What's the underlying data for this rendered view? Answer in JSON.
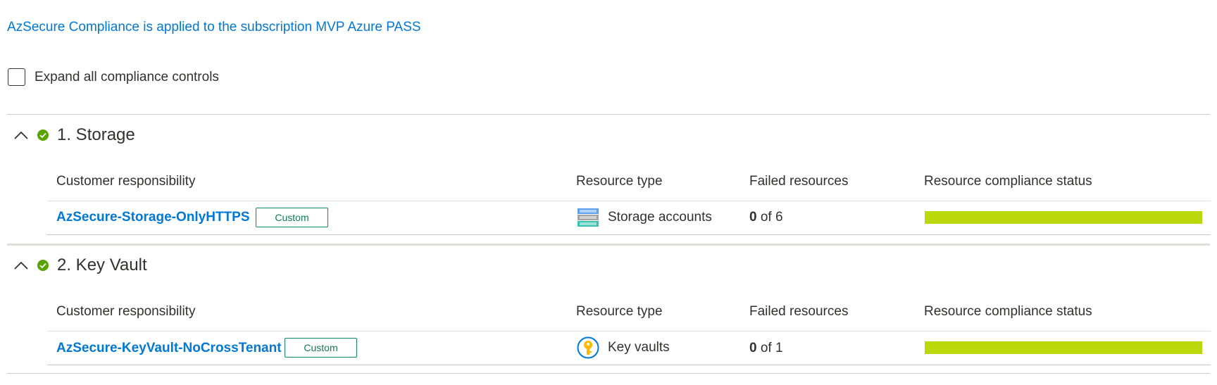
{
  "header": {
    "subtitle": "AzSecure Compliance is applied to the subscription MVP Azure PASS"
  },
  "expand_all": {
    "label": "Expand all compliance controls",
    "checked": false
  },
  "columns": {
    "customer_responsibility": "Customer responsibility",
    "resource_type": "Resource type",
    "failed_resources": "Failed resources",
    "compliance_status": "Resource compliance status"
  },
  "sections": [
    {
      "title": "1. Storage",
      "status": "passed",
      "row": {
        "policy": "AzSecure-Storage-OnlyHTTPS",
        "badge": "Custom",
        "resource_type": "Storage accounts",
        "resource_icon": "storage-account-icon",
        "failed_count": "0",
        "failed_of": "of 6",
        "compliance_fraction": 1.0
      }
    },
    {
      "title": "2. Key Vault",
      "status": "passed",
      "row": {
        "policy": "AzSecure-KeyVault-NoCrossTenant",
        "badge": "Custom",
        "resource_type": "Key vaults",
        "resource_icon": "key-vault-icon",
        "failed_count": "0",
        "failed_of": "of 1",
        "compliance_fraction": 1.0
      }
    }
  ],
  "colors": {
    "link": "#0078d4",
    "success": "#57a300",
    "compliance_bar": "#bad80a",
    "badge_border": "#118a5f"
  }
}
